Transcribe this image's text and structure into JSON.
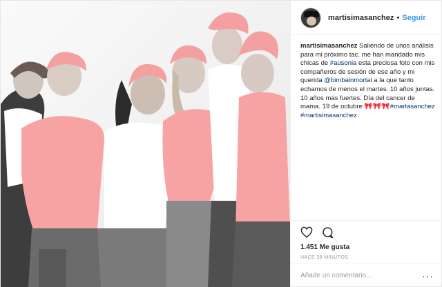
{
  "header": {
    "username": "martisimasanchez",
    "separator": "•",
    "follow_label": "Seguir"
  },
  "photo": {
    "alt": "Grupo de seis personas con pañuelos rosas en la cabeza y camisetas rosas y blancas"
  },
  "caption": {
    "user": "martisimasanchez",
    "text_1": " Saliendo de unos análisis para mi próximo tac. me han mandado mis chicas de ",
    "hashtag_ausonia": "#ausonia",
    "text_2": " esta preciosa foto con mis compañeros de sesión de ese año y mi querida ",
    "mention": "@bimbainmortal",
    "text_3": " a la que tanto echamos de menos el martes. 10 años juntas. 10 años más fuertes. Día del cancer de mama. 19 de octubre ",
    "hearts": "🎀🎀🎀",
    "hashtag_martasanchez": "#martasanchez",
    "hashtag_martisimasanchez": "#martisimasanchez"
  },
  "actions": {
    "like_icon": "heart-outline-icon",
    "comment_icon": "comment-bubble-icon",
    "likes_text": "1.451 Me gusta",
    "time_text": "HACE 38 MINUTOS"
  },
  "comment": {
    "placeholder": "Añade un comentario...",
    "more_label": "···"
  },
  "colors": {
    "link_blue": "#3897f0",
    "hashtag_blue": "#003569",
    "pink_shirt": "#f7a3a3",
    "border": "#efefef"
  }
}
